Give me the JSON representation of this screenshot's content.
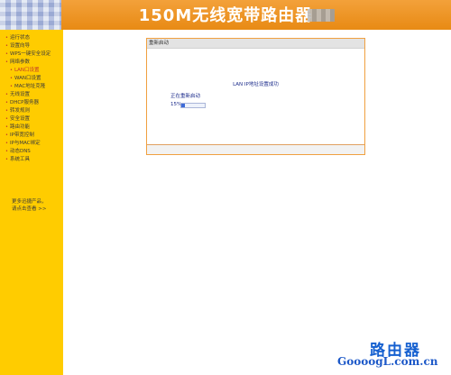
{
  "header": {
    "title": "150M无线宽带路由器"
  },
  "sidebar": {
    "items": [
      {
        "label": "运行状态",
        "sub": false
      },
      {
        "label": "设置向导",
        "sub": false
      },
      {
        "label": "WPS一键安全设定",
        "sub": false
      },
      {
        "label": "网络参数",
        "sub": false
      },
      {
        "label": "LAN口设置",
        "sub": true,
        "active": true
      },
      {
        "label": "WAN口设置",
        "sub": true
      },
      {
        "label": "MAC地址克隆",
        "sub": true
      },
      {
        "label": "无线设置",
        "sub": false
      },
      {
        "label": "DHCP服务器",
        "sub": false
      },
      {
        "label": "转发规则",
        "sub": false
      },
      {
        "label": "安全设置",
        "sub": false
      },
      {
        "label": "路由功能",
        "sub": false
      },
      {
        "label": "IP带宽控制",
        "sub": false
      },
      {
        "label": "IP与MAC绑定",
        "sub": false
      },
      {
        "label": "动态DNS",
        "sub": false
      },
      {
        "label": "系统工具",
        "sub": false
      }
    ],
    "more_line1": "更多迅捷产品，",
    "more_line2": "请点击查看 >>"
  },
  "panel": {
    "title": "重新启动",
    "message": "LAN IP地址设置成功",
    "status": "正在重新启动",
    "progress_text": "15%",
    "progress": 0.15
  },
  "watermark": {
    "cn": "路由器",
    "url": "GoooogL.com.cn"
  },
  "colors": {
    "header": "#e88a14",
    "sidebar": "#ffcc00",
    "panel_border": "#f0a040",
    "progress": "#3d6bd8"
  }
}
